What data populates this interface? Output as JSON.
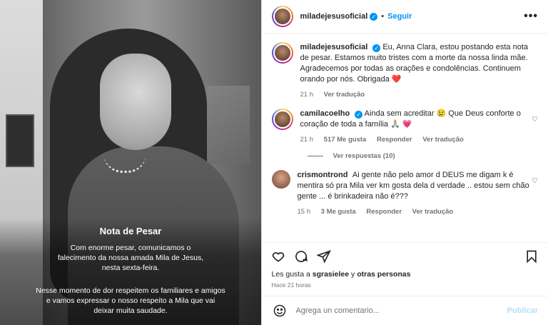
{
  "photo": {
    "title": "Nota de Pesar",
    "paragraph1": "Com enorme pesar, comunicamos o falecimento da nossa amada Mila de Jesus, nesta sexta-feira.",
    "paragraph2": "Nesse momento de dor respeitem os  familiares e amigos e vamos expressar o nosso respeito a Mila que vai deixar muita saudade."
  },
  "header": {
    "username": "miladejesusoficial",
    "verified_icon": "verified-icon",
    "dot": "•",
    "follow_label": "Seguir",
    "more_icon": "more-icon",
    "more_text": "•••"
  },
  "caption": {
    "username": "miladejesusoficial",
    "text": "Eu, Anna Clara, estou postando esta nota de pesar. Estamos muito tristes com a morte da nossa linda mãe. Agradecemos por todas as orações e condolências. Continuem orando por nós. Obrigada ❤️",
    "time": "21 h",
    "translate": "Ver tradução"
  },
  "comments": [
    {
      "username": "camilacoelho",
      "text": "Ainda sem acreditar 😢 Que Deus conforte o coração de toda a família 🙏🏼 💗",
      "time": "21 h",
      "likes": "517 Me gusta",
      "reply": "Responder",
      "translate": "Ver tradução"
    },
    {
      "username": "crismontrond",
      "text": "Ai gente não pelo amor d DEUS me digam k é mentira só pra Mila ver km gosta dela d verdade .. estou sem chão gente ... é brinkadeira não é???",
      "time": "15 h",
      "likes": "3 Me gusta",
      "reply": "Responder",
      "translate": "Ver tradução"
    }
  ],
  "replies_label": "Ver respuestas (10)",
  "actions": {
    "like_icon": "heart-icon",
    "comment_icon": "comment-icon",
    "share_icon": "share-icon",
    "save_icon": "bookmark-icon"
  },
  "likes": {
    "prefix": "Les gusta a",
    "user": "sgrasielee",
    "connector": "y",
    "others": "otras personas"
  },
  "posted": "Hace 21 horas",
  "add_comment": {
    "emoji_icon": "emoji-icon",
    "placeholder": "Agrega un comentario...",
    "publish_label": "Publicar"
  }
}
